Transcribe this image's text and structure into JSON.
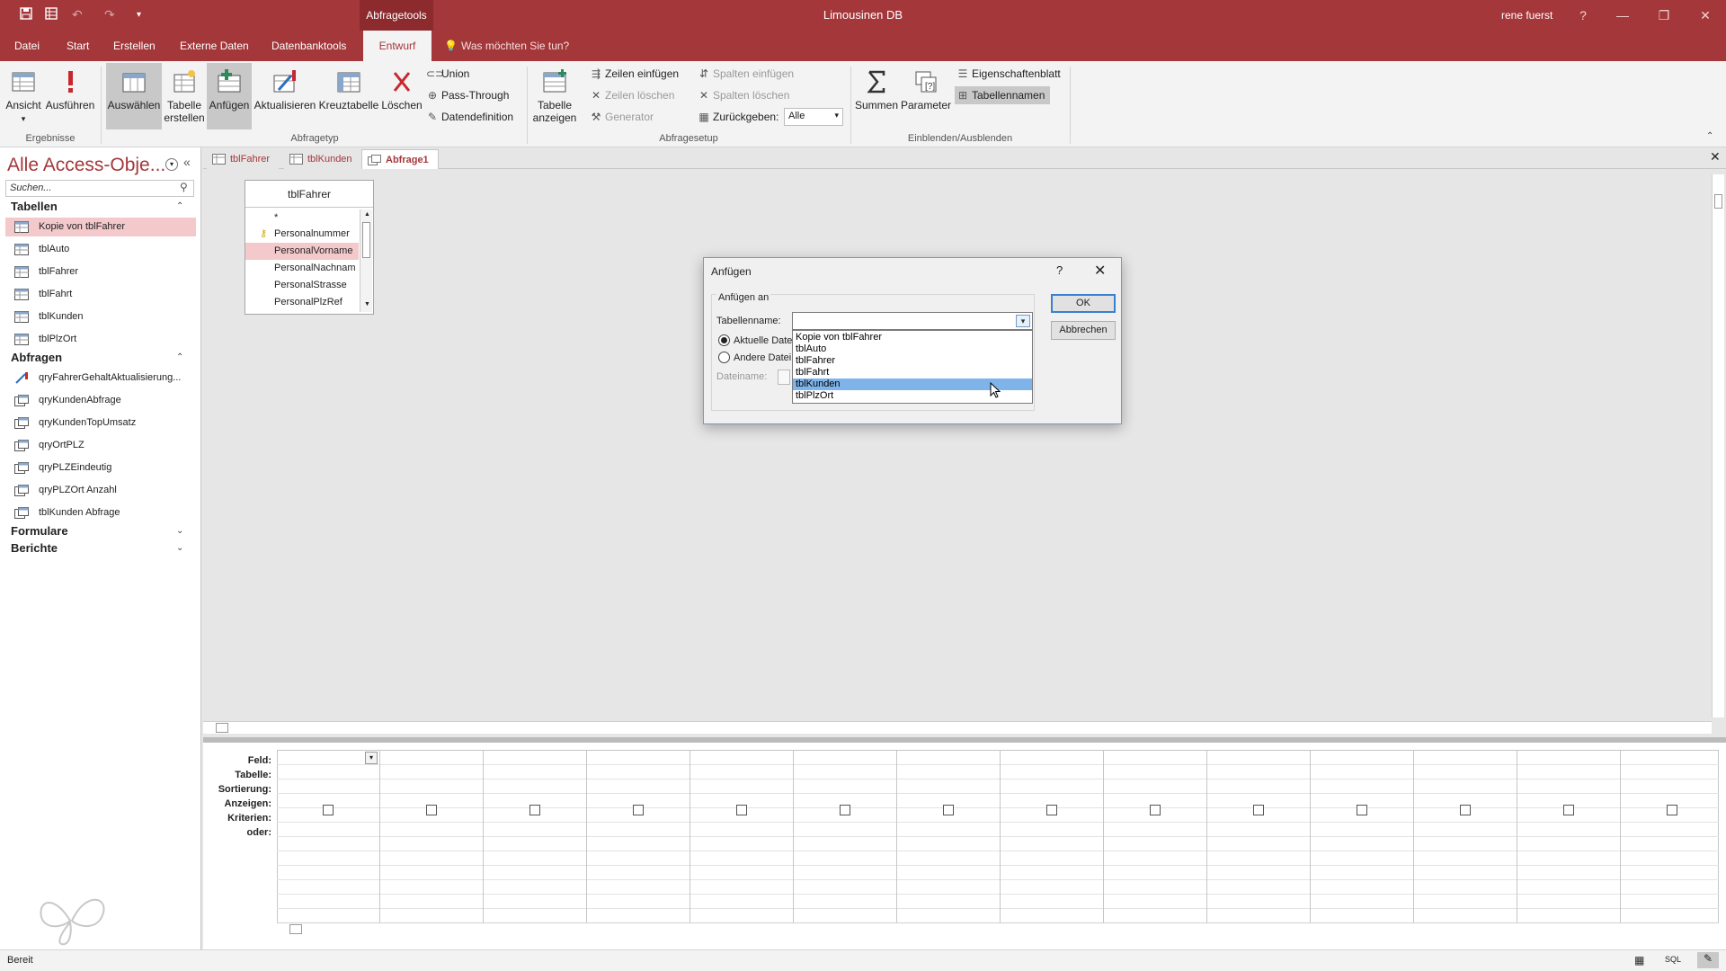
{
  "titlebar": {
    "context_tab": "Abfragetools",
    "app_title": "Limousinen DB",
    "user": "rene fuerst",
    "help": "?",
    "minimize": "—",
    "restore": "❐",
    "close": "✕"
  },
  "tabs": [
    "Datei",
    "Start",
    "Erstellen",
    "Externe Daten",
    "Datenbanktools",
    "Entwurf"
  ],
  "active_tab": "Entwurf",
  "tell_me": "Was möchten Sie tun?",
  "ribbon": {
    "ergebnisse": {
      "label": "Ergebnisse",
      "ansicht": "Ansicht",
      "ausfuehren": "Ausführen"
    },
    "abfragetyp": {
      "label": "Abfragetyp",
      "auswaehlen": "Auswählen",
      "tabelle_erstellen_1": "Tabelle",
      "tabelle_erstellen_2": "erstellen",
      "anfuegen": "Anfügen",
      "aktualisieren": "Aktualisieren",
      "kreuztabelle": "Kreuztabelle",
      "loeschen": "Löschen",
      "union": "Union",
      "pass_through": "Pass-Through",
      "datendefinition": "Datendefinition"
    },
    "abfragesetup": {
      "label": "Abfragesetup",
      "tabelle_anzeigen_1": "Tabelle",
      "tabelle_anzeigen_2": "anzeigen",
      "zeilen_einfuegen": "Zeilen einfügen",
      "zeilen_loeschen": "Zeilen löschen",
      "generator": "Generator",
      "spalten_einfuegen": "Spalten einfügen",
      "spalten_loeschen": "Spalten löschen",
      "zurueckgeben": "Zurückgeben:",
      "zurueckgeben_value": "Alle"
    },
    "einblenden": {
      "label": "Einblenden/Ausblenden",
      "summen": "Summen",
      "parameter": "Parameter",
      "eigenschaftenblatt": "Eigenschaftenblatt",
      "tabellennamen": "Tabellennamen"
    }
  },
  "nav": {
    "title": "Alle Access-Obje...",
    "search_placeholder": "Suchen...",
    "sections": {
      "tabellen": "Tabellen",
      "abfragen": "Abfragen",
      "formulare": "Formulare",
      "berichte": "Berichte"
    },
    "tables": [
      "Kopie von tblFahrer",
      "tblAuto",
      "tblFahrer",
      "tblFahrt",
      "tblKunden",
      "tblPlzOrt"
    ],
    "queries": [
      "qryFahrerGehaltAktualisierung...",
      "qryKundenAbfrage",
      "qryKundenTopUmsatz",
      "qryOrtPLZ",
      "qryPLZEindeutig",
      "qryPLZOrt Anzahl",
      "tblKunden Abfrage"
    ]
  },
  "doc_tabs": [
    "tblFahrer",
    "tblKunden",
    "Abfrage1"
  ],
  "table_box": {
    "title": "tblFahrer",
    "fields": [
      "*",
      "Personalnummer",
      "PersonalVorname",
      "PersonalNachnam",
      "PersonalStrasse",
      "PersonalPlzRef"
    ]
  },
  "grid": {
    "rows": [
      "Feld:",
      "Tabelle:",
      "Sortierung:",
      "Anzeigen:",
      "Kriterien:",
      "oder:"
    ]
  },
  "status": {
    "text": "Bereit",
    "sql": "SQL"
  },
  "dialog": {
    "title": "Anfügen",
    "help": "?",
    "close": "✕",
    "anfuegen_an": "Anfügen an",
    "tabellenname_label": "Tabellenname:",
    "tabellenname_value": "",
    "aktuelle_db": "Aktuelle Date",
    "andere_db": "Andere Datei",
    "dateiname_label": "Dateiname:",
    "ok": "OK",
    "abbrechen": "Abbrechen",
    "options": [
      "Kopie von tblFahrer",
      "tblAuto",
      "tblFahrer",
      "tblFahrt",
      "tblKunden",
      "tblPlzOrt"
    ],
    "highlighted": "tblKunden"
  }
}
